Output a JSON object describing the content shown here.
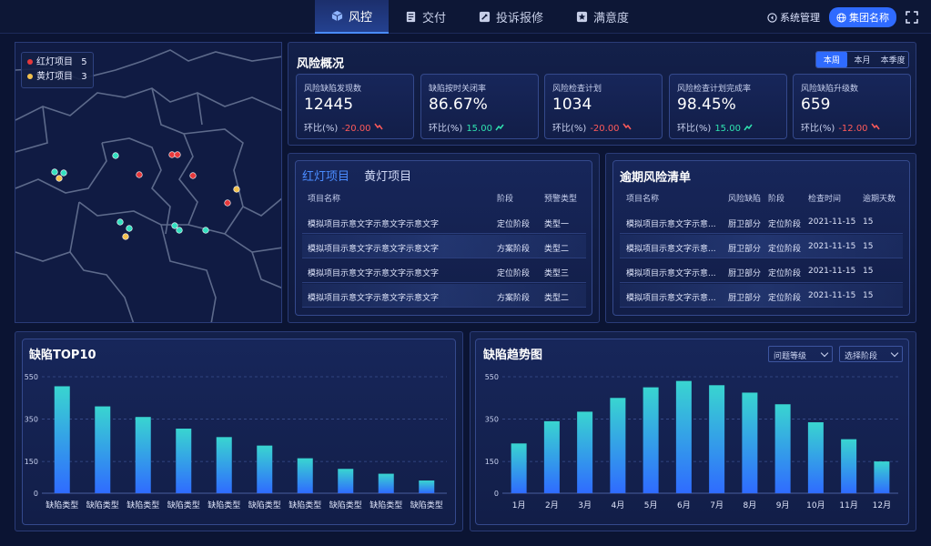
{
  "nav": {
    "items": [
      {
        "label": "风控",
        "icon": "cube-icon",
        "active": true
      },
      {
        "label": "交付",
        "icon": "document-icon",
        "active": false
      },
      {
        "label": "投诉报修",
        "icon": "wrench-icon",
        "active": false
      },
      {
        "label": "满意度",
        "icon": "star-icon",
        "active": false
      }
    ]
  },
  "topright": {
    "system": "系统管理",
    "group": "集团名称"
  },
  "map": {
    "legend": [
      {
        "label": "红灯项目",
        "count": "5",
        "color": "#e5383b"
      },
      {
        "label": "黄灯项目",
        "count": "3",
        "color": "#f2c14e"
      }
    ]
  },
  "overview": {
    "title": "风险概况",
    "tabs": [
      "本周",
      "本月",
      "本季度"
    ],
    "active_tab": 0,
    "kpis": [
      {
        "label": "风险缺陷发现数",
        "value": "12445",
        "cmp_label": "环比(%)",
        "delta": "-20.00",
        "dir": "down"
      },
      {
        "label": "缺陷按时关闭率",
        "value": "86.67%",
        "cmp_label": "环比(%)",
        "delta": "15.00",
        "dir": "up"
      },
      {
        "label": "风险检查计划",
        "value": "1034",
        "cmp_label": "环比(%)",
        "delta": "-20.00",
        "dir": "down"
      },
      {
        "label": "风险检查计划完成率",
        "value": "98.45%",
        "cmp_label": "环比(%)",
        "delta": "15.00",
        "dir": "up"
      },
      {
        "label": "风险缺陷升级数",
        "value": "659",
        "cmp_label": "环比(%)",
        "delta": "-12.00",
        "dir": "down"
      }
    ],
    "up_color": "#2fe3b0",
    "down_color": "#ff5a5a"
  },
  "projects": {
    "tabs": [
      "红灯项目",
      "黄灯项目"
    ],
    "active_tab": 0,
    "headers": [
      "项目名称",
      "阶段",
      "预警类型"
    ],
    "rows": [
      [
        "模拟项目示意文字示意文字示意文字",
        "定位阶段",
        "类型一"
      ],
      [
        "模拟项目示意文字示意文字示意文字",
        "方案阶段",
        "类型二"
      ],
      [
        "模拟项目示意文字示意文字示意文字",
        "定位阶段",
        "类型三"
      ],
      [
        "模拟项目示意文字示意文字示意文字",
        "方案阶段",
        "类型二"
      ]
    ]
  },
  "overdue": {
    "title": "逾期风险清单",
    "headers": [
      "项目名称",
      "风险缺陷",
      "阶段",
      "检查时间",
      "逾期天数"
    ],
    "rows": [
      [
        "模拟项目示意文字示意...",
        "厨卫部分",
        "定位阶段",
        "2021-11-15",
        "15"
      ],
      [
        "模拟项目示意文字示意...",
        "厨卫部分",
        "定位阶段",
        "2021-11-15",
        "15"
      ],
      [
        "模拟项目示意文字示意...",
        "厨卫部分",
        "定位阶段",
        "2021-11-15",
        "15"
      ],
      [
        "模拟项目示意文字示意...",
        "厨卫部分",
        "定位阶段",
        "2021-11-15",
        "15"
      ]
    ]
  },
  "trend": {
    "title": "缺陷趋势图",
    "select1": "问题等级",
    "select2": "选择阶段"
  },
  "chart_data": [
    {
      "type": "bar",
      "title": "缺陷TOP10",
      "categories": [
        "缺陷类型",
        "缺陷类型",
        "缺陷类型",
        "缺陷类型",
        "缺陷类型",
        "缺陷类型",
        "缺陷类型",
        "缺陷类型",
        "缺陷类型",
        "缺陷类型"
      ],
      "values": [
        505,
        410,
        360,
        305,
        265,
        225,
        165,
        115,
        92,
        60
      ],
      "yticks": [
        "550",
        "350",
        "150",
        "0"
      ],
      "ylim": [
        0,
        550
      ],
      "ytick_values": [
        550,
        350,
        150,
        0
      ],
      "colors": [
        "#39d5d0",
        "#2f6bff"
      ]
    },
    {
      "type": "bar",
      "title": "缺陷趋势图",
      "categories": [
        "1月",
        "2月",
        "3月",
        "4月",
        "5月",
        "6月",
        "7月",
        "8月",
        "9月",
        "10月",
        "11月",
        "12月"
      ],
      "values": [
        235,
        340,
        385,
        450,
        500,
        530,
        510,
        475,
        420,
        335,
        255,
        150
      ],
      "yticks": [
        "550",
        "350",
        "150",
        "0"
      ],
      "ylim": [
        0,
        550
      ],
      "ytick_values": [
        550,
        350,
        150,
        0
      ],
      "colors": [
        "#39d5d0",
        "#2f6bff"
      ]
    }
  ]
}
